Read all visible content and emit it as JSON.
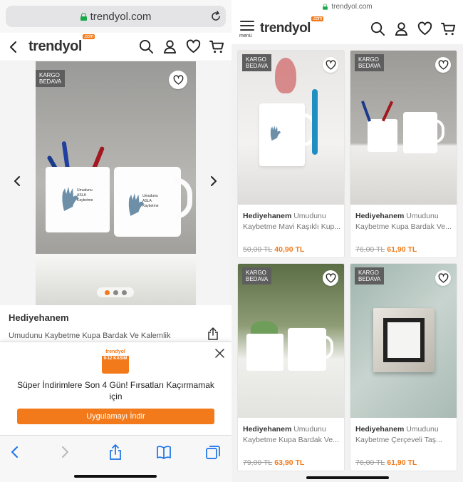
{
  "left": {
    "browser": {
      "url": "trendyol.com"
    },
    "header": {
      "logo": "trendyol",
      "logo_badge": ".com"
    },
    "product": {
      "badge": [
        "KARGO",
        "BEDAVA"
      ],
      "brand": "Hediyehanem",
      "name": "Umudunu Kaybetme Kupa Bardak Ve Kalemlik",
      "mug_text": [
        "Umudunu",
        "ASLA",
        "Kaybetme"
      ],
      "carousel": {
        "count": 3,
        "active": 1
      }
    },
    "promo": {
      "logo_top": "trendyol",
      "logo_date": "9-12 KASIM",
      "message": "Süper İndirimlere Son 4 Gün! Fırsatları Kaçırmamak için",
      "button": "Uygulamayı İndir"
    }
  },
  "right": {
    "browser": {
      "url": "trendyol.com"
    },
    "header": {
      "menu_label": "menü",
      "logo": "trendyol",
      "logo_badge": ".com"
    },
    "products": [
      {
        "badge": [
          "KARGO",
          "BEDAVA"
        ],
        "brand": "Hediyehanem",
        "title_start": "Umudunu",
        "title_rest": "Kaybetme Mavi Kaşıklı Kup...",
        "old_price": "50,00 TL",
        "price": "40,90 TL"
      },
      {
        "badge": [
          "KARGO",
          "BEDAVA"
        ],
        "brand": "Hediyehanem",
        "title_start": "Umudunu",
        "title_rest": "Kaybetme Kupa Bardak Ve...",
        "old_price": "76,00 TL",
        "price": "61,90 TL"
      },
      {
        "badge": [
          "KARGO",
          "BEDAVA"
        ],
        "brand": "Hediyehanem",
        "title_start": "Umudunu",
        "title_rest": "Kaybetme Kupa Bardak Ve...",
        "old_price": "79,00 TL",
        "price": "63,90 TL"
      },
      {
        "badge": [
          "KARGO",
          "BEDAVA"
        ],
        "brand": "Hediyehanem",
        "title_start": "Umudunu",
        "title_rest": "Kaybetme Çerçeveli Taş...",
        "old_price": "76,00 TL",
        "price": "61,90 TL"
      }
    ]
  },
  "colors": {
    "accent": "#f27a1a",
    "secure": "#1aa84a",
    "ios_blue": "#1a73e8"
  },
  "icons": [
    "lock-icon",
    "reload-icon",
    "back-chevron-icon",
    "search-icon",
    "user-icon",
    "heart-icon",
    "cart-icon",
    "share-icon",
    "close-icon",
    "bookmarks-icon",
    "tabs-icon",
    "menu-icon"
  ]
}
